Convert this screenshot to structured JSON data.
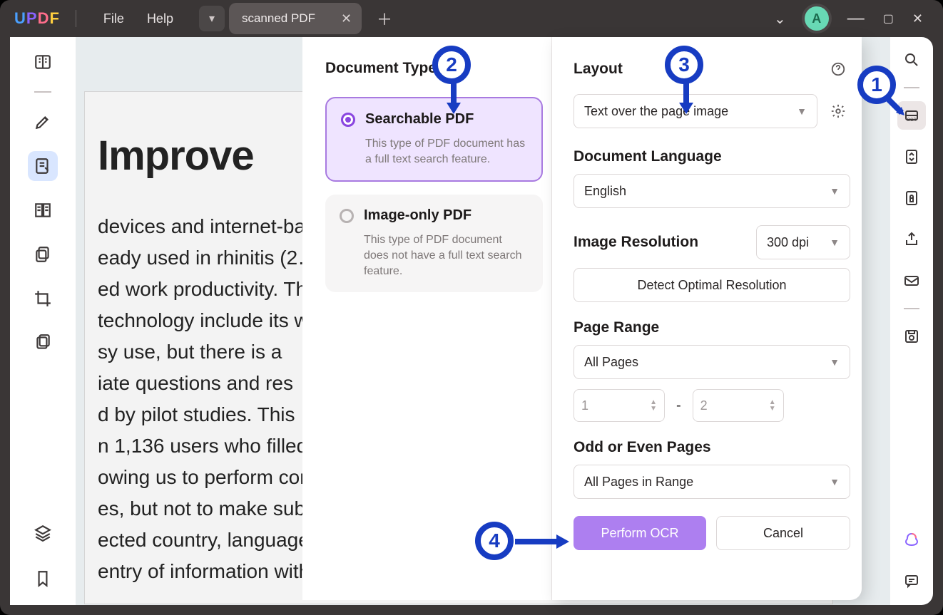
{
  "titlebar": {
    "menu_file": "File",
    "menu_help": "Help",
    "tab_label": "scanned PDF",
    "avatar_letter": "A"
  },
  "doc_preview": {
    "heading": "Improve",
    "body": "devices and internet-bas…\neady used in rhinitis (2…\ned work productivity. The\ntechnology include its w\nsy use, but there is a\niate questions and res\nd by pilot studies. This\nn 1,136 users who filled\nowing us to perform com\nes, but not to make subgr\nected country, language,\nentry of information with the App. We"
  },
  "doc_type": {
    "heading": "Document Type",
    "opt1_title": "Searchable PDF",
    "opt1_desc": "This type of PDF document has a full text search feature.",
    "opt2_title": "Image-only PDF",
    "opt2_desc": "This type of PDF document does not have a full text search feature."
  },
  "settings": {
    "layout_label": "Layout",
    "layout_value": "Text over the page image",
    "lang_label": "Document Language",
    "lang_value": "English",
    "res_label": "Image Resolution",
    "res_value": "300 dpi",
    "detect_btn": "Detect Optimal Resolution",
    "range_label": "Page Range",
    "range_value": "All Pages",
    "range_from": "1",
    "range_dash": "-",
    "range_to": "2",
    "odd_label": "Odd or Even Pages",
    "odd_value": "All Pages in Range",
    "perform": "Perform OCR",
    "cancel": "Cancel"
  },
  "callouts": {
    "c1": "1",
    "c2": "2",
    "c3": "3",
    "c4": "4"
  }
}
